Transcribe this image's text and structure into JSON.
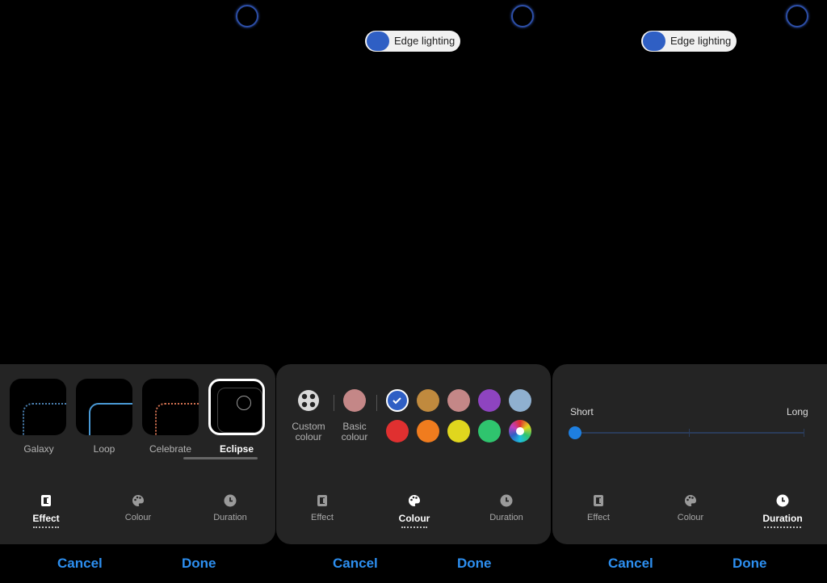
{
  "edge_toggle_label": "Edge lighting",
  "accent_color": "#2d8ff0",
  "panels": [
    {
      "effects": [
        {
          "label": "Galaxy"
        },
        {
          "label": "Loop"
        },
        {
          "label": "Celebrate"
        },
        {
          "label": "Eclipse",
          "selected": true
        }
      ]
    },
    {
      "custom_label_1": "Custom",
      "custom_label_2": "colour",
      "basic_label_1": "Basic",
      "basic_label_2": "colour",
      "swatches_row1": [
        "#2f5fc4",
        "#c08a3e",
        "#c48787",
        "#8e44c0",
        "#8fb0d0"
      ],
      "swatches_row2": [
        "#e03030",
        "#f07c1e",
        "#e0d61e",
        "#2fc46e",
        "rainbow"
      ],
      "selected_swatch": 0,
      "basic_swatch": "#c48787"
    },
    {
      "slider_min": "Short",
      "slider_max": "Long",
      "slider_value": 0
    }
  ],
  "tabs": {
    "effect": "Effect",
    "colour": "Colour",
    "duration": "Duration"
  },
  "actions": {
    "cancel": "Cancel",
    "done": "Done"
  }
}
